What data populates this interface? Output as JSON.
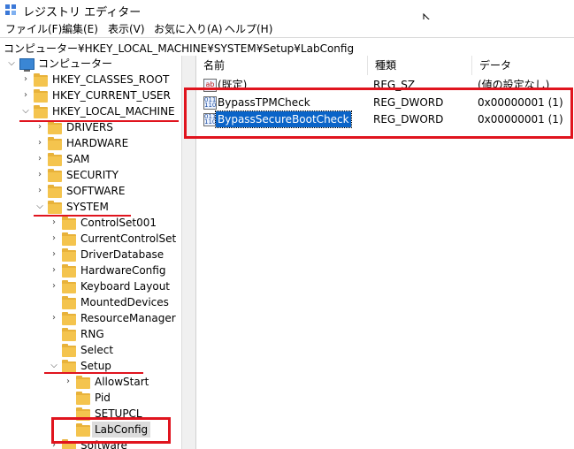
{
  "window": {
    "title": "レジストリ エディター"
  },
  "menu": [
    "ファイル(F)",
    "編集(E)",
    "表示(V)",
    "お気に入り(A)",
    "ヘルプ(H)"
  ],
  "address": "コンピューター¥HKEY_LOCAL_MACHINE¥SYSTEM¥Setup¥LabConfig",
  "tree": {
    "root": "コンピューター",
    "hives": [
      "HKEY_CLASSES_ROOT",
      "HKEY_CURRENT_USER",
      "HKEY_LOCAL_MACHINE"
    ],
    "hklm_children": [
      "DRIVERS",
      "HARDWARE",
      "SAM",
      "SECURITY",
      "SOFTWARE",
      "SYSTEM"
    ],
    "system_children": [
      "ControlSet001",
      "CurrentControlSet",
      "DriverDatabase",
      "HardwareConfig",
      "Keyboard Layout",
      "MountedDevices",
      "ResourceManager",
      "RNG",
      "Select",
      "Setup"
    ],
    "setup_children": [
      "AllowStart",
      "Pid",
      "SETUPCL",
      "LabConfig"
    ],
    "next_item": "Software",
    "selected": "LabConfig"
  },
  "list": {
    "headers": [
      "名前",
      "種類",
      "データ"
    ],
    "rows": [
      {
        "icon": "ab",
        "name": "(既定)",
        "type": "REG_SZ",
        "data": "(値の設定なし)"
      },
      {
        "icon": "dword",
        "name": "BypassTPMCheck",
        "type": "REG_DWORD",
        "data": "0x00000001 (1)"
      },
      {
        "icon": "dword",
        "name": "BypassSecureBootCheck",
        "type": "REG_DWORD",
        "data": "0x00000001 (1)"
      }
    ]
  },
  "colors": {
    "annotation_red": "#e0141e",
    "selection_blue": "#0a64c8",
    "folder_yellow": "#f4c44e"
  }
}
